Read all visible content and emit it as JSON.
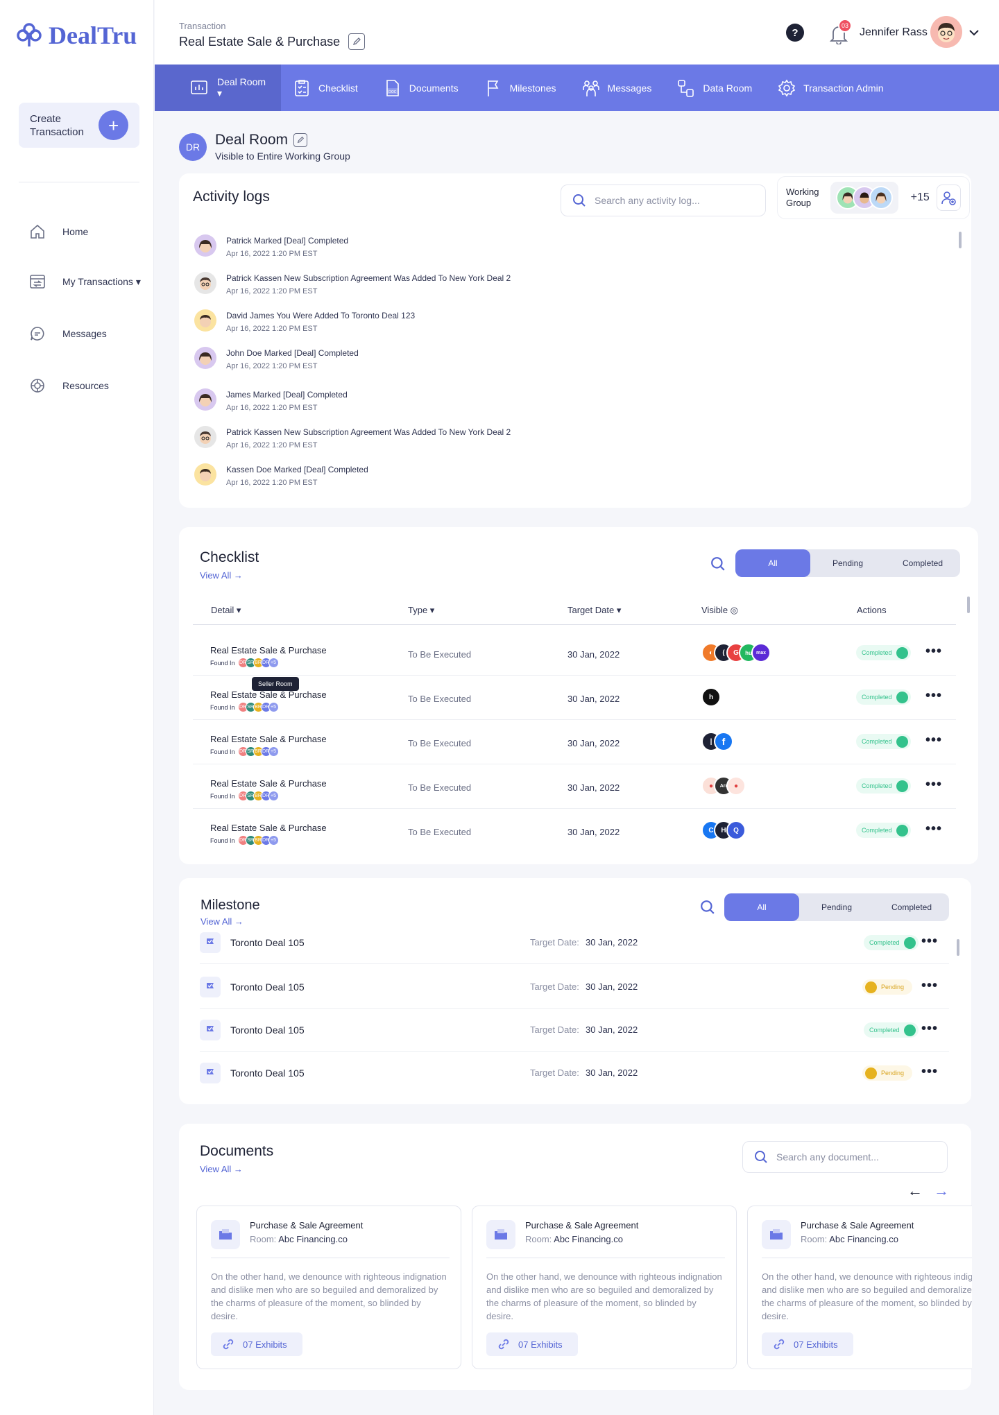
{
  "brand": {
    "name": "DealTru",
    "accent": "#6b79e6",
    "accent_dark": "#5465d4"
  },
  "sidebar": {
    "create_label": "Create Transaction",
    "items": [
      {
        "label": "Home",
        "icon": "home-icon"
      },
      {
        "label": "My Transactions ▾",
        "icon": "transactions-icon"
      },
      {
        "label": "Messages",
        "icon": "chat-icon"
      },
      {
        "label": "Resources",
        "icon": "resources-icon"
      }
    ]
  },
  "header": {
    "label": "Transaction",
    "title": "Real Estate Sale & Purchase",
    "notifications": "03",
    "user_name": "Jennifer Rass"
  },
  "tabs": [
    {
      "label": "Deal Room ▾",
      "icon": "chart-icon"
    },
    {
      "label": "Checklist",
      "icon": "checklist-icon"
    },
    {
      "label": "Documents",
      "icon": "document-icon"
    },
    {
      "label": "Milestones",
      "icon": "flag-icon"
    },
    {
      "label": "Messages",
      "icon": "group-icon"
    },
    {
      "label": "Data Room",
      "icon": "data-room-icon"
    },
    {
      "label": "Transaction Admin",
      "icon": "gear-icon"
    }
  ],
  "deal_room": {
    "initials": "DR",
    "title": "Deal Room",
    "subtitle": "Visible to Entire Working Group"
  },
  "activity": {
    "title": "Activity logs",
    "search_placeholder": "Search any activity log...",
    "logs": [
      {
        "text": "Patrick Marked [Deal] Completed",
        "time": "Apr 16, 2022 1:20 PM EST"
      },
      {
        "text": "Patrick Kassen New Subscription Agreement Was Added To New York Deal 2",
        "time": "Apr 16, 2022 1:20 PM EST"
      },
      {
        "text": "David James You Were Added To Toronto Deal 123",
        "time": "Apr 16, 2022 1:20 PM EST"
      },
      {
        "text": "John Doe Marked [Deal] Completed",
        "time": "Apr 16, 2022 1:20 PM EST"
      },
      {
        "text": "James Marked [Deal] Completed",
        "time": "Apr 16, 2022 1:20 PM EST"
      },
      {
        "text": "Patrick Kassen New Subscription Agreement Was Added To New York Deal 2",
        "time": "Apr 16, 2022 1:20 PM EST"
      },
      {
        "text": "Kassen Doe Marked [Deal] Completed",
        "time": "Apr 16, 2022 1:20 PM EST"
      }
    ]
  },
  "working_group": {
    "label": "Working Group",
    "extra": "+15"
  },
  "checklist": {
    "title": "Checklist",
    "view_all": "View All →",
    "filters": [
      "All",
      "Pending",
      "Completed"
    ],
    "columns": [
      "Detail ▾",
      "Type ▾",
      "Target Date ▾",
      "Visible ◎",
      "Actions"
    ],
    "found_in": "Found In",
    "mini_avatars": [
      "DR",
      "SR",
      "BR",
      "DR",
      "+5"
    ],
    "tooltip": "Seller Room",
    "rows": [
      {
        "detail": "Real Estate Sale & Purchase",
        "type": "To Be Executed",
        "date": "30 Jan, 2022",
        "status": "Completed"
      },
      {
        "detail": "Real Estate Sale & Purchase",
        "type": "To Be Executed",
        "date": "30 Jan, 2022",
        "status": "Completed"
      },
      {
        "detail": "Real Estate Sale & Purchase",
        "type": "To Be Executed",
        "date": "30 Jan, 2022",
        "status": "Completed"
      },
      {
        "detail": "Real Estate Sale & Purchase",
        "type": "To Be Executed",
        "date": "30 Jan, 2022",
        "status": "Completed"
      },
      {
        "detail": "Real Estate Sale & Purchase",
        "type": "To Be Executed",
        "date": "30 Jan, 2022",
        "status": "Completed"
      }
    ]
  },
  "milestone": {
    "title": "Milestone",
    "view_all": "View All →",
    "filters": [
      "All",
      "Pending",
      "Completed"
    ],
    "target_label": "Target Date:",
    "rows": [
      {
        "name": "Toronto Deal 105",
        "date": "30 Jan, 2022",
        "status": "Completed"
      },
      {
        "name": "Toronto Deal 105",
        "date": "30 Jan, 2022",
        "status": "Pending"
      },
      {
        "name": "Toronto Deal 105",
        "date": "30 Jan, 2022",
        "status": "Completed"
      },
      {
        "name": "Toronto Deal 105",
        "date": "30 Jan, 2022",
        "status": "Pending"
      }
    ]
  },
  "documents": {
    "title": "Documents",
    "view_all": "View All →",
    "search_placeholder": "Search any document...",
    "room_label": "Room:",
    "cards": [
      {
        "title": "Purchase & Sale Agreement",
        "room": "Abc Financing.co",
        "desc": "On the other hand, we denounce with righteous indignation and dislike men who are so beguiled and demoralized by the charms of pleasure of the moment, so blinded by desire.",
        "exhibits": "07 Exhibits"
      },
      {
        "title": "Purchase & Sale Agreement",
        "room": "Abc Financing.co",
        "desc": "On the other hand, we denounce with righteous indignation and dislike men who are so beguiled and demoralized by the charms of pleasure of the moment, so blinded by desire.",
        "exhibits": "07 Exhibits"
      },
      {
        "title": "Purchase & Sale Agreement",
        "room": "Abc Financing.co",
        "desc": "On the other hand, we denounce with righteous indignation and dislike men who are so beguiled and demoralized by the charms of pleasure of the moment, so blinded by desire.",
        "exhibits": "07 Exhibits"
      }
    ]
  }
}
